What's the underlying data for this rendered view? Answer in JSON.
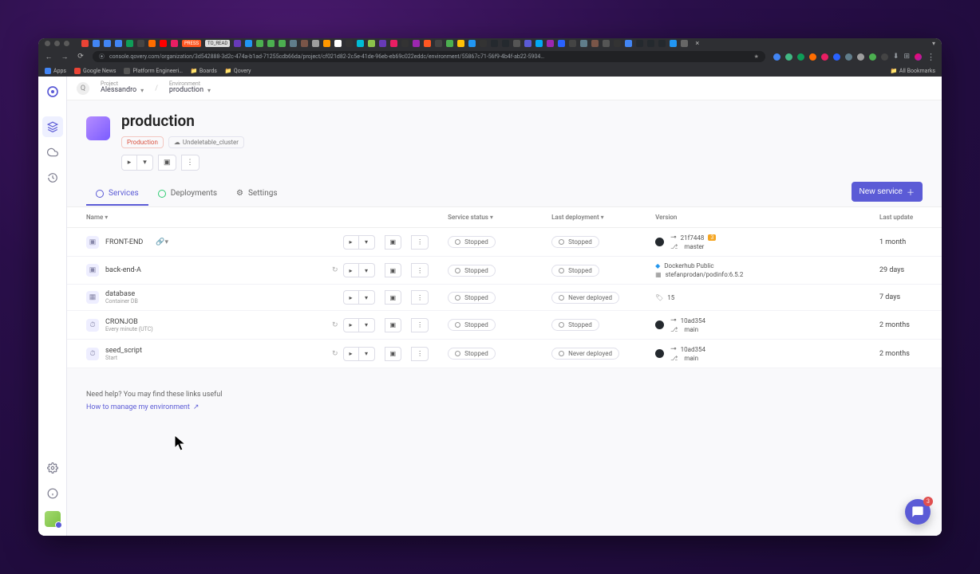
{
  "browser": {
    "url": "console.qovery.com/organization/3d542888-3d2c-474a-b1ad-71255cdb66da/project/cf021d82-2c5e-41de-96eb-eb69c022eddc/environment/55867c71-56f9-4b4f-ab22-5904…",
    "tab_badge": "PRESS",
    "tab_badge2": "TO_READ",
    "bookmarks": {
      "apps": "Apps",
      "google_news": "Google News",
      "platform": "Platform Engineeri…",
      "boards": "Boards",
      "qovery": "Qovery",
      "all": "All Bookmarks"
    }
  },
  "breadcrumb": {
    "project_label": "Project",
    "project_value": "Alessandro",
    "env_label": "Environment",
    "env_value": "production"
  },
  "hero": {
    "title": "production",
    "tag_production": "Production",
    "tag_cluster": "Undeletable_cluster"
  },
  "tabs": {
    "services": "Services",
    "deployments": "Deployments",
    "settings": "Settings",
    "new_service": "New service"
  },
  "table": {
    "headers": {
      "name": "Name",
      "service_status": "Service status",
      "last_deployment": "Last deployment",
      "version": "Version",
      "last_update": "Last update"
    },
    "rows": [
      {
        "name": "FRONT-END",
        "sub": "",
        "has_link": true,
        "status": "Stopped",
        "last_deploy": "Stopped",
        "version_hash": "21f7448",
        "version_badge": "3",
        "branch": "master",
        "github": true,
        "update": "1 month"
      },
      {
        "name": "back-end-A",
        "sub": "",
        "has_refresh": true,
        "status": "Stopped",
        "last_deploy": "Stopped",
        "version_line1": "Dockerhub Public",
        "version_line2": "stefanprodan/podinfo:6.5.2",
        "update": "29 days"
      },
      {
        "name": "database",
        "sub": "Container DB",
        "status": "Stopped",
        "last_deploy": "Never deployed",
        "version_line1": "15",
        "update": "7 days"
      },
      {
        "name": "CRONJOB",
        "sub": "Every minute (UTC)",
        "has_refresh": true,
        "status": "Stopped",
        "last_deploy": "Stopped",
        "version_hash": "10ad354",
        "branch": "main",
        "github": true,
        "update": "2 months"
      },
      {
        "name": "seed_script",
        "sub": "Start",
        "has_refresh": true,
        "status": "Stopped",
        "last_deploy": "Never deployed",
        "version_hash": "10ad354",
        "branch": "main",
        "github": true,
        "update": "2 months"
      }
    ]
  },
  "footer": {
    "help_text": "Need help? You may find these links useful",
    "link": "How to manage my environment"
  },
  "chat_count": "3"
}
